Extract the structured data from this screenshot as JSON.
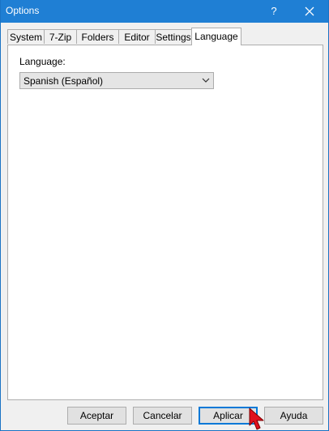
{
  "window": {
    "title": "Options",
    "help_label": "?"
  },
  "tabs": [
    {
      "label": "System",
      "active": false
    },
    {
      "label": "7-Zip",
      "active": false
    },
    {
      "label": "Folders",
      "active": false
    },
    {
      "label": "Editor",
      "active": false
    },
    {
      "label": "Settings",
      "active": false
    },
    {
      "label": "Language",
      "active": true
    }
  ],
  "language_panel": {
    "label": "Language:",
    "selected_value": "Spanish (Español)"
  },
  "buttons": {
    "ok_label": "Aceptar",
    "cancel_label": "Cancelar",
    "apply_label": "Aplicar",
    "help_label": "Ayuda"
  },
  "colors": {
    "titlebar": "#1f7fd4",
    "focus_border": "#0078d7",
    "cursor": "#e0101e"
  }
}
